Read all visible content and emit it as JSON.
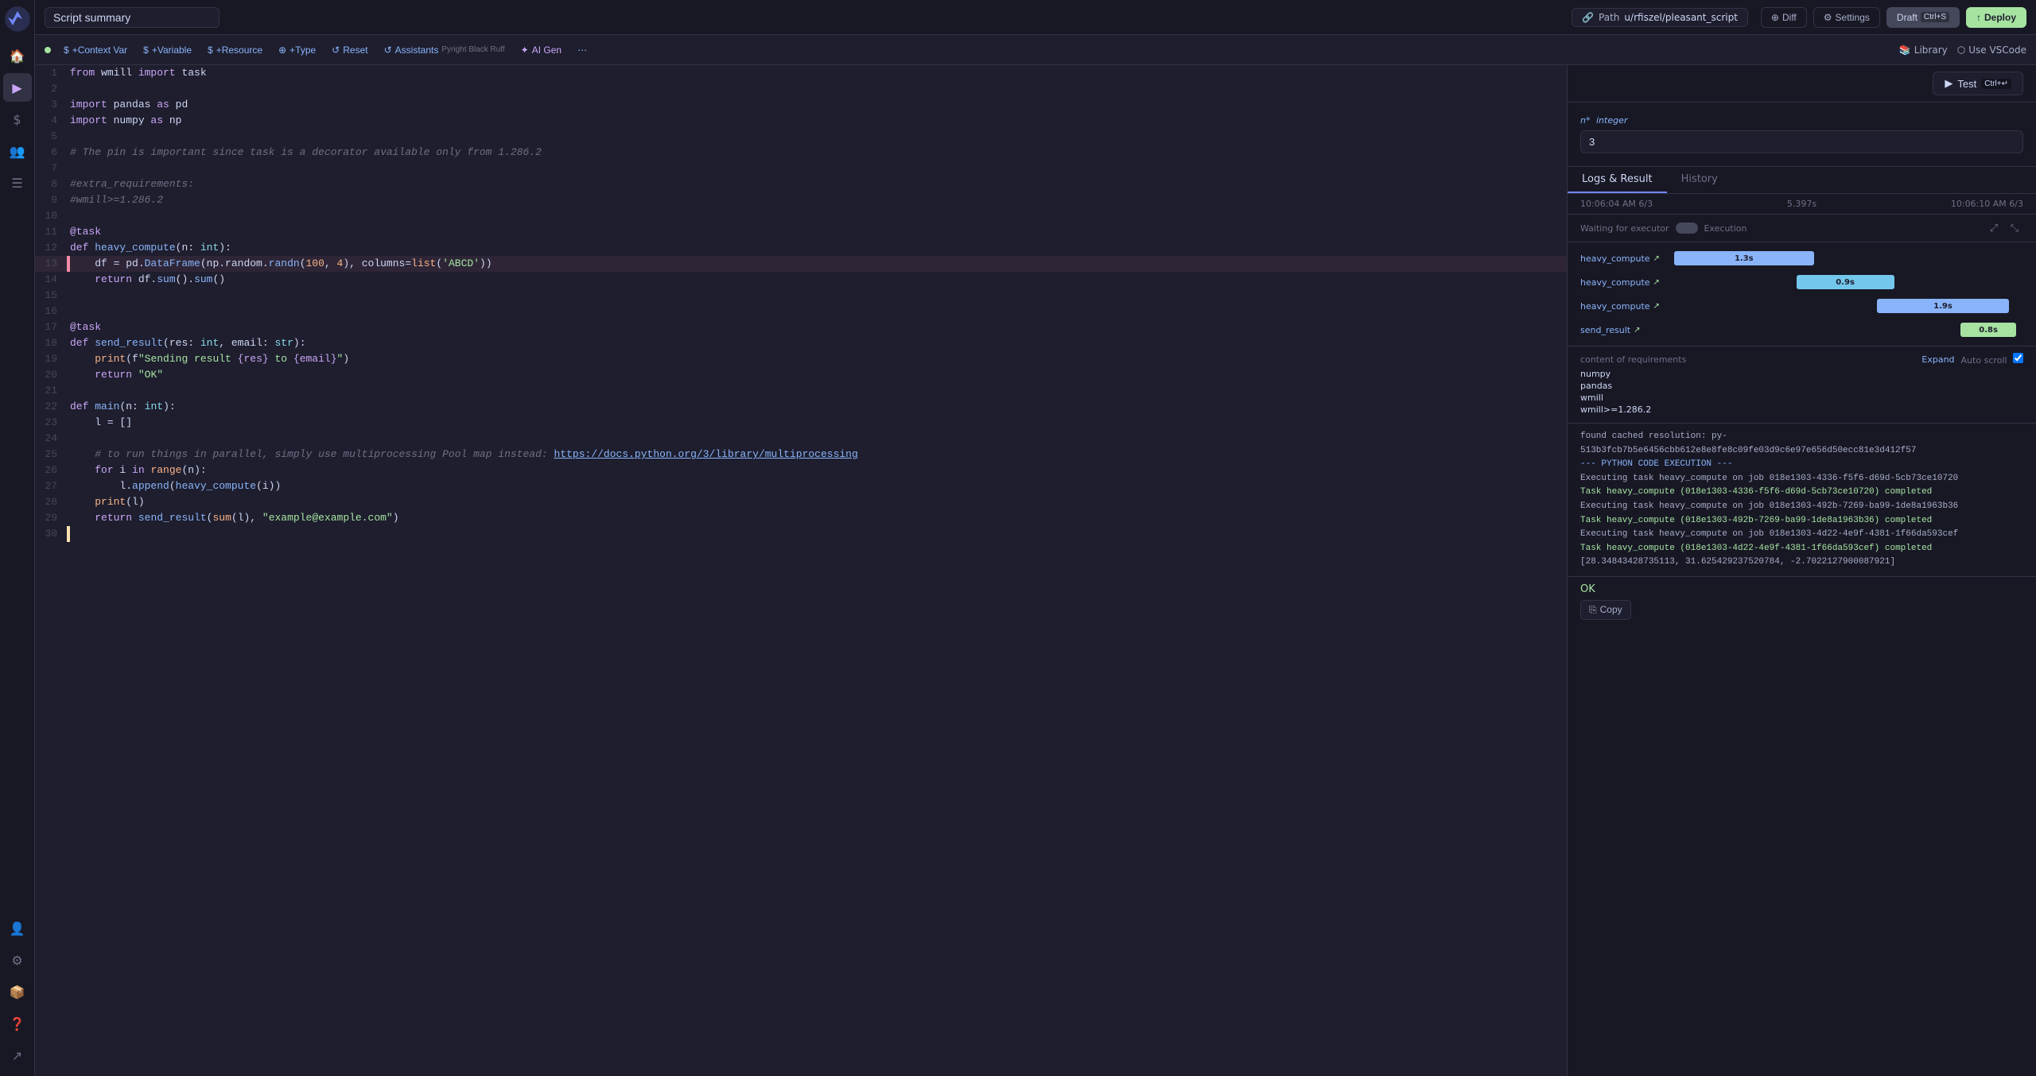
{
  "app": {
    "logo": "⚡"
  },
  "topbar": {
    "title": "Script summary",
    "path_icon": "🔗",
    "path_label": "Path",
    "path_value": "u/rfiszel/pleasant_script",
    "diff_label": "Diff",
    "settings_label": "Settings",
    "draft_label": "Draft",
    "draft_shortcut": "Ctrl+S",
    "deploy_label": "Deploy"
  },
  "toolbar": {
    "status_dot": "●",
    "context_var": "+Context Var",
    "variable": "+Variable",
    "resource": "+Resource",
    "type": "+Type",
    "reset": "Reset",
    "assistants": "Assistants",
    "assistants_sub": "Pyright Black Ruff",
    "ai_gen": "AI Gen",
    "library_label": "Library",
    "use_vscode_label": "Use VSCode"
  },
  "code_lines": [
    {
      "num": 1,
      "content": "from wmill import task",
      "marker": ""
    },
    {
      "num": 2,
      "content": "",
      "marker": ""
    },
    {
      "num": 3,
      "content": "import pandas as pd",
      "marker": ""
    },
    {
      "num": 4,
      "content": "import numpy as np",
      "marker": ""
    },
    {
      "num": 5,
      "content": "",
      "marker": ""
    },
    {
      "num": 6,
      "content": "# The pin is important since task is a decorator available only from 1.286.2",
      "marker": ""
    },
    {
      "num": 7,
      "content": "",
      "marker": ""
    },
    {
      "num": 8,
      "content": "#extra_requirements:",
      "marker": ""
    },
    {
      "num": 9,
      "content": "#wmill>=1.286.2",
      "marker": ""
    },
    {
      "num": 10,
      "content": "",
      "marker": ""
    },
    {
      "num": 11,
      "content": "@task",
      "marker": ""
    },
    {
      "num": 12,
      "content": "def heavy_compute(n: int):",
      "marker": ""
    },
    {
      "num": 13,
      "content": "    df = pd.DataFrame(np.random.randn(100, 4), columns=list('ABCD'))",
      "marker": "red"
    },
    {
      "num": 14,
      "content": "    return df.sum().sum()",
      "marker": ""
    },
    {
      "num": 15,
      "content": "",
      "marker": ""
    },
    {
      "num": 16,
      "content": "",
      "marker": ""
    },
    {
      "num": 17,
      "content": "@task",
      "marker": ""
    },
    {
      "num": 18,
      "content": "def send_result(res: int, email: str):",
      "marker": ""
    },
    {
      "num": 19,
      "content": "    print(f\"Sending result {res} to {email}\")",
      "marker": ""
    },
    {
      "num": 20,
      "content": "    return \"OK\"",
      "marker": ""
    },
    {
      "num": 21,
      "content": "",
      "marker": ""
    },
    {
      "num": 22,
      "content": "def main(n: int):",
      "marker": ""
    },
    {
      "num": 23,
      "content": "    l = []",
      "marker": ""
    },
    {
      "num": 24,
      "content": "",
      "marker": ""
    },
    {
      "num": 25,
      "content": "    # to run things in parallel, simply use multiprocessing Pool map instead: https://docs.python.org/3/library/multiprocessing",
      "marker": ""
    },
    {
      "num": 26,
      "content": "    for i in range(n):",
      "marker": ""
    },
    {
      "num": 27,
      "content": "        l.append(heavy_compute(i))",
      "marker": ""
    },
    {
      "num": 28,
      "content": "    print(l)",
      "marker": ""
    },
    {
      "num": 29,
      "content": "    return send_result(sum(l), \"example@example.com\")",
      "marker": ""
    },
    {
      "num": 30,
      "content": "",
      "marker": "yellow"
    }
  ],
  "right_panel": {
    "param_label": "n*",
    "param_type": "integer",
    "param_value": "3",
    "test_label": "Test",
    "test_shortcut": "Ctrl+↵",
    "tabs": [
      "Logs & Result",
      "History"
    ],
    "active_tab": "Logs & Result",
    "timing": {
      "start": "10:06:04 AM 6/3",
      "duration": "5.397s",
      "end": "10:06:10 AM 6/3"
    },
    "exec_status": {
      "waiting": "Waiting for executor",
      "label": "Execution"
    },
    "gantt_rows": [
      {
        "label": "heavy_compute",
        "bar_text": "1.3s",
        "bar_left": "0%",
        "bar_width": "35%",
        "bar_color": "bar-blue"
      },
      {
        "label": "heavy_compute",
        "bar_text": "0.9s",
        "bar_left": "35%",
        "bar_width": "25%",
        "bar_color": "bar-blue2"
      },
      {
        "label": "heavy_compute",
        "bar_text": "1.9s",
        "bar_left": "55%",
        "bar_width": "40%",
        "bar_color": "bar-blue"
      },
      {
        "label": "send_result",
        "bar_text": "0.8s",
        "bar_left": "80%",
        "bar_width": "18%",
        "bar_color": "bar-green"
      }
    ],
    "requirements_header": "content of requirements",
    "requirements": [
      "numpy",
      "pandas",
      "wmill",
      "wmill>=1.286.2"
    ],
    "expand_label": "Expand",
    "autoscroll_label": "Auto scroll",
    "logs": [
      "found cached resolution: py-513b3fcb7b5e6456cbb612e8e8fe8c09fe03d9c6e97e656d50ecc81e3d412f57",
      "",
      "--- PYTHON CODE EXECUTION ---",
      "",
      "Executing task heavy_compute on job 018e1303-4336-f5f6-d69d-5cb73ce10720",
      "Task heavy_compute (018e1303-4336-f5f6-d69d-5cb73ce10720) completed",
      "Executing task heavy_compute on job 018e1303-492b-7269-ba99-1de8a1963b36",
      "Task heavy_compute (018e1303-492b-7269-ba99-1de8a1963b36) completed",
      "Executing task heavy_compute on job 018e1303-4d22-4e9f-4381-1f66da593cef",
      "Task heavy_compute (018e1303-4d22-4e9f-4381-1f66da593cef) completed",
      "[28.34843428735113, 31.625429237520784, -2.7022127900087921]"
    ],
    "output_ok": "OK",
    "copy_label": "Copy"
  },
  "sidebar": {
    "icons": [
      "⚡",
      "🏠",
      "▶",
      "$",
      "👥",
      "📋",
      "👤",
      "⚙",
      "📦",
      "❓",
      "↗"
    ]
  }
}
